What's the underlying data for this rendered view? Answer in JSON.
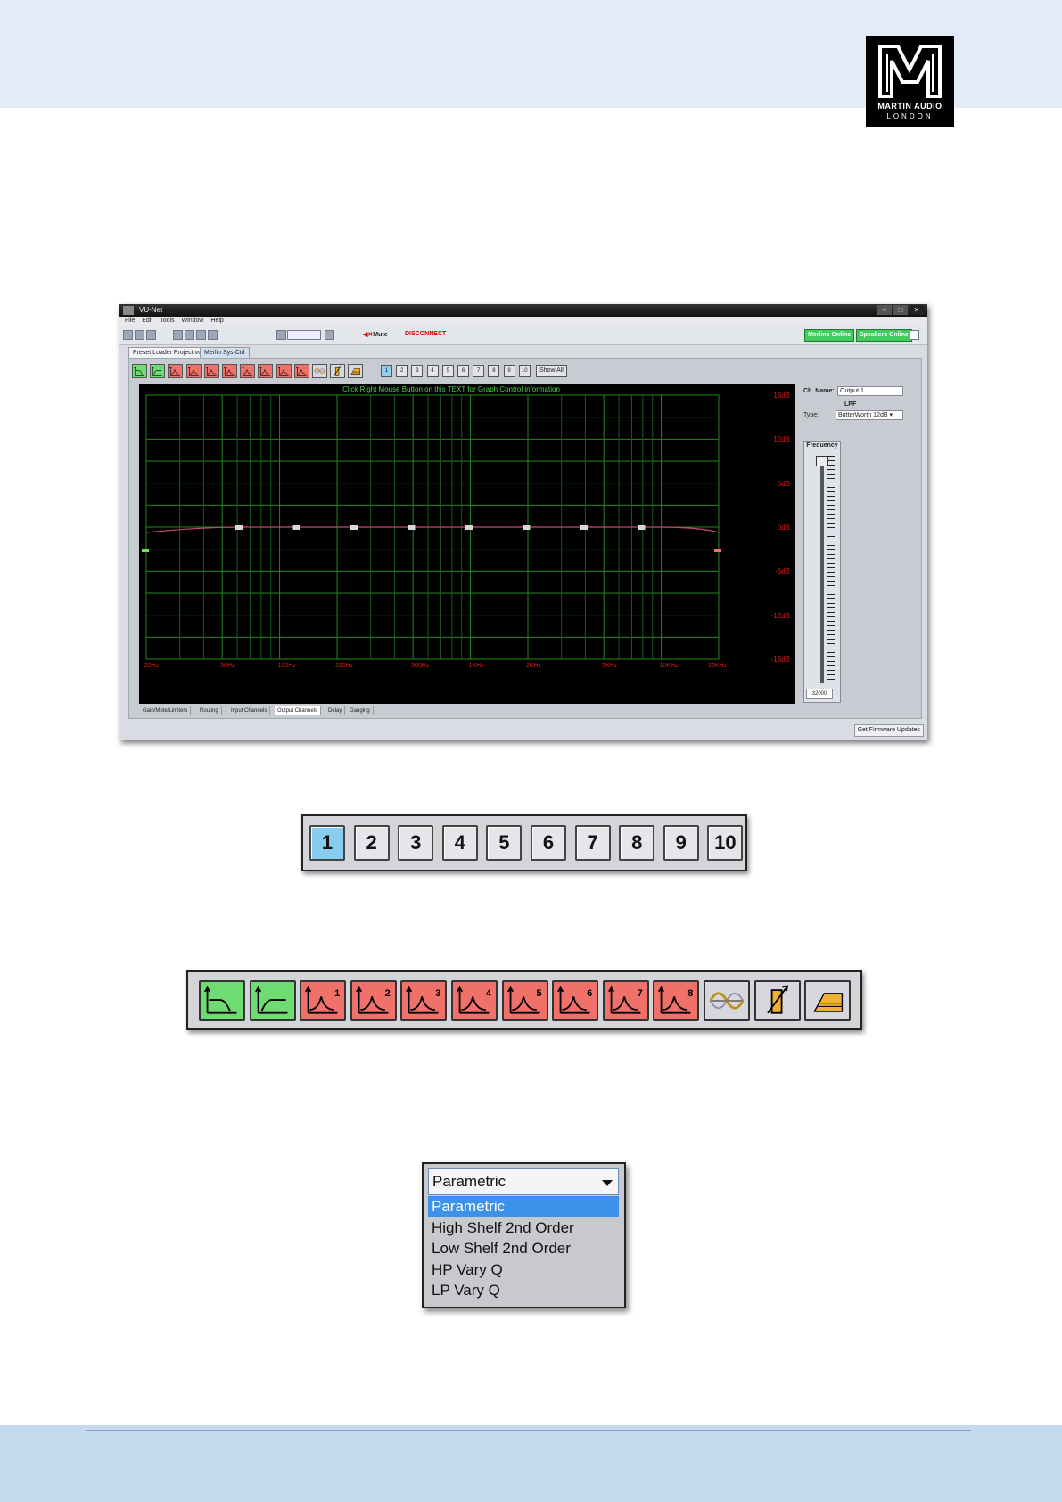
{
  "logo": {
    "brand": "MARTIN AUDIO",
    "sub": "LONDON"
  },
  "app": {
    "title": "VU-Net",
    "window_controls": [
      "–",
      "□",
      "✕"
    ],
    "menu": [
      "File",
      "Edit",
      "Tools",
      "Window",
      "Help"
    ],
    "mute_label": "Mute",
    "disconnect_label": "DISCONNECT",
    "status": {
      "merlins": "Merlins Online",
      "speakers": "Speakers Online"
    },
    "doc_tabs": [
      "Preset Loader Project.vuvn",
      "Merlin Sys Ctrl"
    ],
    "filter_buttons": [
      {
        "icon": "high-pass-filter-icon",
        "state": "on",
        "num": ""
      },
      {
        "icon": "low-pass-filter-icon",
        "state": "on",
        "num": ""
      },
      {
        "icon": "parametric-eq-band-icon",
        "state": "off",
        "num": "1"
      },
      {
        "icon": "parametric-eq-band-icon",
        "state": "off",
        "num": "2"
      },
      {
        "icon": "parametric-eq-band-icon",
        "state": "off",
        "num": "3"
      },
      {
        "icon": "parametric-eq-band-icon",
        "state": "off",
        "num": "4"
      },
      {
        "icon": "parametric-eq-band-icon",
        "state": "off",
        "num": "5"
      },
      {
        "icon": "parametric-eq-band-icon",
        "state": "off",
        "num": "6"
      },
      {
        "icon": "parametric-eq-band-icon",
        "state": "off",
        "num": "7"
      },
      {
        "icon": "parametric-eq-band-icon",
        "state": "off",
        "num": "8"
      },
      {
        "icon": "phase-wave-icon",
        "state": "neutral",
        "num": ""
      },
      {
        "icon": "gain-slope-icon",
        "state": "neutral",
        "num": ""
      },
      {
        "icon": "limiter-icon",
        "state": "neutral",
        "num": ""
      }
    ],
    "channels": [
      "1",
      "2",
      "3",
      "4",
      "5",
      "6",
      "7",
      "8",
      "9",
      "10"
    ],
    "selected_channel": "1",
    "show_all_label": "Show All",
    "graph_hint": "Click Right Mouse Button on this TEXT for Graph Control information",
    "db_labels": [
      "18dB",
      "12dB",
      "6dB",
      "0dB",
      "-6dB",
      "-12dB",
      "-18dB"
    ],
    "hz_labels": [
      "20Hz",
      "50Hz",
      "100Hz",
      "200Hz",
      "500Hz",
      "1KHz",
      "2KHz",
      "5KHz",
      "10KHz",
      "20KHz"
    ],
    "side": {
      "ch_name_label": "Ch. Name:",
      "ch_name_value": "Output 1",
      "section_title": "LPF",
      "type_label": "Type:",
      "type_value": "ButterWorth 12dB",
      "frequency_title": "Frequency",
      "frequency_value": "32000"
    },
    "bottom_tabs": [
      "Gain/Mute/Limiters",
      "Routing",
      "Input Channels",
      "Output Channels",
      "Delay",
      "Ganging"
    ],
    "active_bottom_tab": "Output Channels",
    "firmware_label": "Get Firmware Updates"
  },
  "dropdown": {
    "selected": "Parametric",
    "options": [
      "Parametric",
      "High Shelf 2nd Order",
      "Low Shelf 2nd Order",
      "HP Vary Q",
      "LP Vary Q"
    ]
  },
  "colors": {
    "filter_on": "#6fdc72",
    "filter_off": "#f0706a",
    "graph_grid": "#1f8a1f",
    "graph_label": "#e01a1a",
    "selected_channel": "#86cdf0"
  }
}
